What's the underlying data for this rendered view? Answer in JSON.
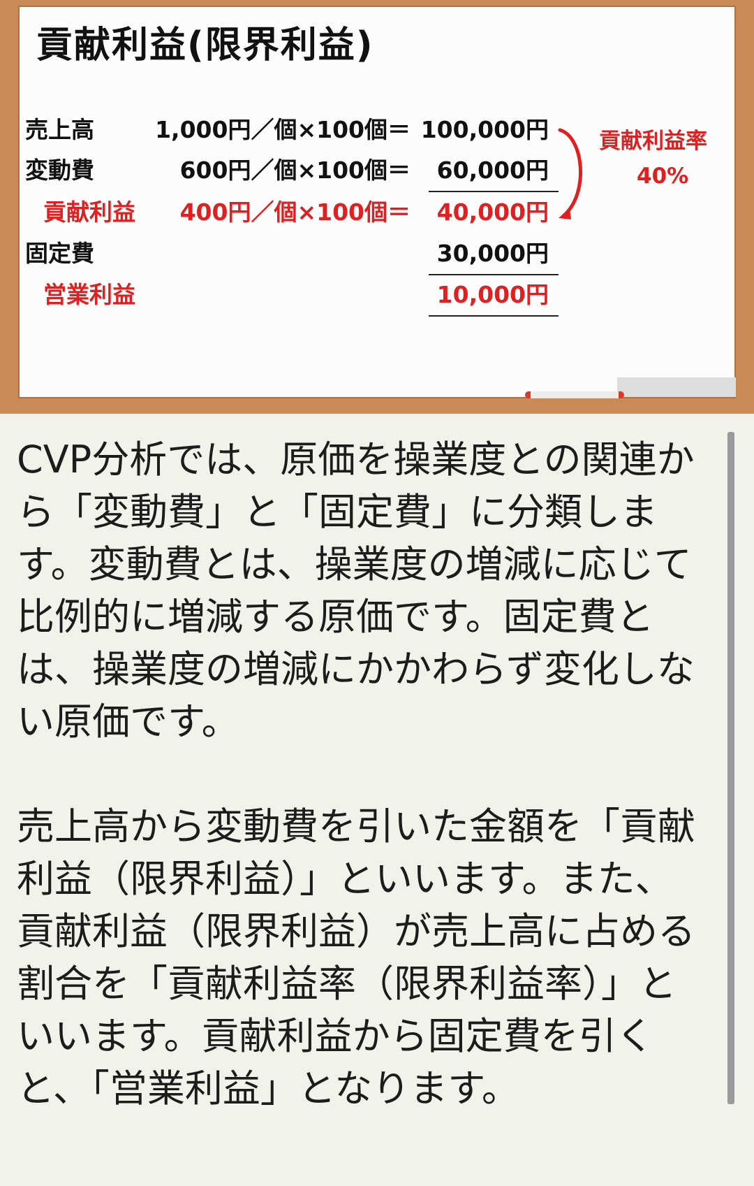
{
  "board": {
    "title": "貢献利益(限界利益)",
    "rows": [
      {
        "label": "売上高",
        "calc": "1,000円／個×100個＝",
        "amount": "100,000円",
        "red": false,
        "indent": false
      },
      {
        "label": "変動費",
        "calc": "600円／個×100個＝",
        "amount": "60,000円",
        "red": false,
        "indent": false
      },
      {
        "label": "貢献利益",
        "calc": "400円／個×100個＝",
        "amount": "40,000円",
        "red": true,
        "indent": true
      },
      {
        "label": "固定費",
        "calc": "",
        "amount": "30,000円",
        "red": false,
        "indent": false
      },
      {
        "label": "営業利益",
        "calc": "",
        "amount": "10,000円",
        "red": true,
        "indent": true
      }
    ],
    "rate_label": "貢献利益率",
    "rate_value": "40%",
    "accent_color": "#e02020",
    "frame_color": "#c98a56"
  },
  "text": {
    "paragraph1": "CVP分析では、原価を操業度との関連から「変動費」と「固定費」に分類します。変動費とは、操業度の増減に応じて比例的に増減する原価です。固定費とは、操業度の増減にかかわらず変化しない原価です。",
    "paragraph2": "売上高から変動費を引いた金額を「貢献利益（限界利益）」といいます。また、貢献利益（限界利益）が売上高に占める割合を「貢献利益率（限界利益率）」といいます。貢献利益から固定費を引くと、「営業利益」となります。"
  }
}
